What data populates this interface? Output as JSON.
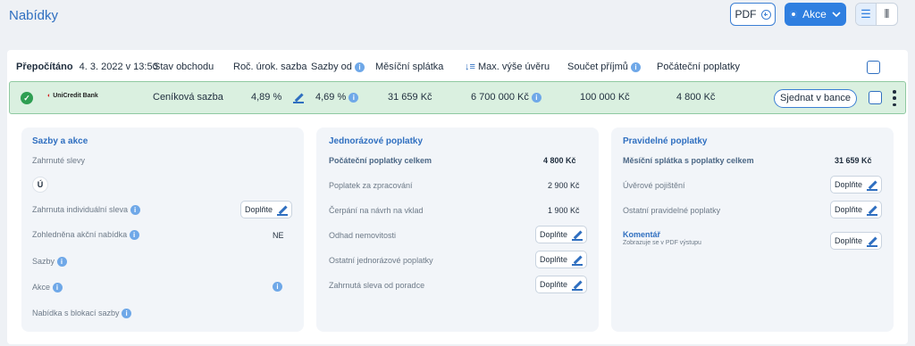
{
  "header": {
    "title": "Nabídky",
    "pdf_label": "PDF",
    "akce_label": "Akce"
  },
  "table": {
    "status_title": "Přepočítáno",
    "status_time": "4. 3. 2022 v 13:50",
    "columns": {
      "stav": "Stav obchodu",
      "roc": "Roč. úrok. sazba",
      "sazby_od": "Sazby od",
      "mesicni": "Měsíční splátka",
      "max_vyse": "Max. výše úvěru",
      "soucet": "Součet příjmů",
      "pocatecni": "Počáteční poplatky"
    },
    "row": {
      "bank": "UniCredit Bank",
      "stav": "Ceníková sazba",
      "roc": "4,89 %",
      "sazby_od": "4,69 %",
      "mesicni": "31 659 Kč",
      "max_vyse": "6 700 000 Kč",
      "soucet": "100 000 Kč",
      "pocatecni": "4 800 Kč",
      "action": "Sjednat v bance"
    }
  },
  "sazby": {
    "title": "Sazby a akce",
    "zahnute_slevy": "Zahrnuté slevy",
    "u_badge": "Ú",
    "individualni": "Zahrnuta individuální sleva",
    "akcni": "Zohledněna akční nabídka",
    "akcni_value": "NE",
    "sazby": "Sazby",
    "akce": "Akce",
    "blokace": "Nabídka s blokací sazby"
  },
  "jednorazove": {
    "title": "Jednorázové poplatky",
    "celkem": "Počáteční poplatky celkem",
    "celkem_value": "4 800 Kč",
    "zpracovani": "Poplatek za zpracování",
    "zpracovani_value": "2 900 Kč",
    "cerpani": "Čerpání na návrh na vklad",
    "cerpani_value": "1 900 Kč",
    "odhad": "Odhad nemovitosti",
    "ostatni": "Ostatní jednorázové poplatky",
    "sleva": "Zahrnutá sleva od poradce"
  },
  "pravidelne": {
    "title": "Pravidelné poplatky",
    "splatka": "Měsíční splátka s poplatky celkem",
    "splatka_value": "31 659 Kč",
    "pojisteni": "Úvěrové pojištění",
    "ostatni": "Ostatní pravidelné poplatky",
    "komentar": "Komentář",
    "komentar_sub": "Zobrazuje se v PDF výstupu"
  },
  "doplnte_label": "Doplňte"
}
